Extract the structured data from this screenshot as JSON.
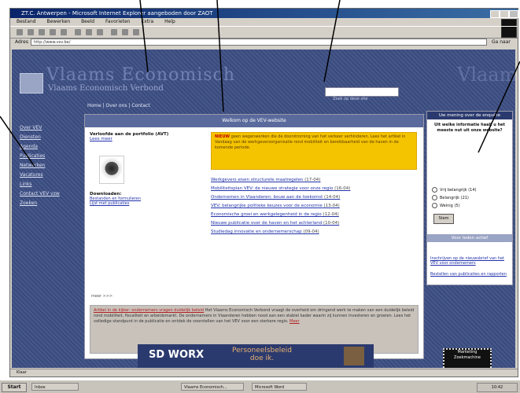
{
  "window": {
    "title": "ZT.C. Antwerpen - Microsoft Internet Explorer aangeboden door ZAOT"
  },
  "menu": [
    "Bestand",
    "Bewerken",
    "Beeld",
    "Favorieten",
    "Extra",
    "Help"
  ],
  "address": {
    "label": "Adres",
    "value": "http://www.vsv.be/",
    "go": "Ga naar"
  },
  "site": {
    "name": "Vlaams Economisch",
    "subtitle": "Vlaams Economisch Verbond",
    "right_mark": "Vlaams",
    "search_label": "Zoek op deze site",
    "topnav": "Home | Over ons | Contact"
  },
  "leftnav": [
    "Over VEV",
    "Diensten",
    "Agenda",
    "Publicaties",
    "Netwerken",
    "Vacatures",
    "Links",
    "Contact VEV vzw",
    "Zoeken"
  ],
  "main": {
    "header": "Welkom op de VEV-website",
    "left_title": "Verloofde aan de portfolio (AVT)",
    "left_link": "Lees meer",
    "tools_label": "Downloaden:",
    "tools_links": [
      "Bestanden en formulieren",
      "Lijst met publicaties"
    ],
    "highlight_bold": "NIEUW",
    "highlight_text": "geen wegenwerken die de doorstroming van het verkeer verhinderen. Lees het artikel in Vandaag van de werkgeversorganisatie rond mobiliteit en bereikbaarheid van de haven in de komende periode.",
    "articles": [
      {
        "text": "Werkgevers eisen structurele maatregelen",
        "src": "(17-04)"
      },
      {
        "text": "Mobiliteitsplan VEV: de nieuwe strategie voor onze regio",
        "src": "(16-04)"
      },
      {
        "text": "Ondernemen in Vlaanderen: bouw aan de toekomst",
        "src": "(14-04)"
      },
      {
        "text": "VEV: belangrijke politieke keuzes voor de economie",
        "src": "(13-04)"
      },
      {
        "text": "Economische groei en werkgelegenheid in de regio",
        "src": "(12-04)"
      },
      {
        "text": "Nieuwe publicatie over de haven en het achterland",
        "src": "(10-04)"
      },
      {
        "text": "Studiedag innovatie en ondernemerschap",
        "src": "(09-04)"
      }
    ],
    "more": "meer >>>",
    "bottom_lead": "Artikel in de kijker: ondernemers vragen duidelijk beleid",
    "bottom_text": "Het Vlaams Economisch Verbond vraagt de overheid om dringend werk te maken van een duidelijk beleid rond mobiliteit, fiscaliteit en arbeidsmarkt. De ondernemers in Vlaanderen hebben nood aan een stabiel kader waarin zij kunnen investeren en groeien. Lees het volledige standpunt in de publicatie en ontdek de voorstellen van het VEV voor een sterkere regio.",
    "bottom_more": "Meer"
  },
  "poll": {
    "header": "Uw mening over de enquête",
    "question": "Uit welke informatie haalt u het meeste nut uit onze website?",
    "options": [
      "Vrij belangrijk (14)",
      "Belangrijk (21)",
      "Weinig (5)"
    ],
    "vote": "Stem"
  },
  "subscribe": {
    "header": "Voor leden actief",
    "links": [
      "Inschrijven op de nieuwsbrief van het VEV voor ondernemers",
      "Bestellen van publicaties en rapporten"
    ]
  },
  "banner": {
    "logo": "SD WORX",
    "text_line1": "Personeelsbeleid",
    "text_line2": "doe ik."
  },
  "sticker": {
    "line1": "Marketing",
    "line2": "Zoekmachine"
  },
  "status": "Klaar",
  "taskbar": {
    "start": "Start",
    "items": [
      "Inbox",
      "Vlaams Economisch...",
      "Microsoft Word"
    ],
    "clock": "10:42"
  },
  "colors": {
    "accent": "#2b3a6e",
    "highlight": "#f5c400",
    "background": "#3a4a7c"
  }
}
